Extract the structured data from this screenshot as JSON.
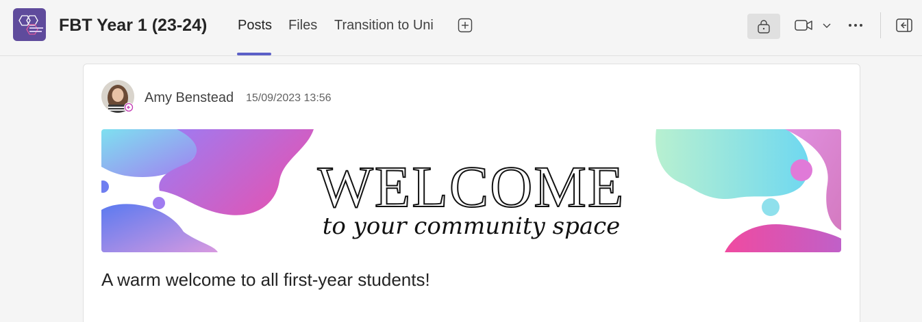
{
  "header": {
    "team_name": "FBT Year 1 (23-24)",
    "tabs": [
      {
        "label": "Posts",
        "active": true
      },
      {
        "label": "Files",
        "active": false
      },
      {
        "label": "Transition to Uni",
        "active": false
      }
    ],
    "icons": [
      "add-tab-icon",
      "shopping-bag-icon",
      "video-camera-icon",
      "chevron-down-icon",
      "more-horizontal-icon",
      "side-pane-icon"
    ]
  },
  "post": {
    "author": "Amy Benstead",
    "timestamp": "15/09/2023 13:56",
    "banner": {
      "title": "WELCOME",
      "subtitle": "to your community space"
    },
    "message": "A warm welcome to all first-year students!"
  },
  "colors": {
    "accent": "#5b5fc7",
    "team_avatar": "#5f4b9c",
    "background": "#f5f5f5"
  }
}
